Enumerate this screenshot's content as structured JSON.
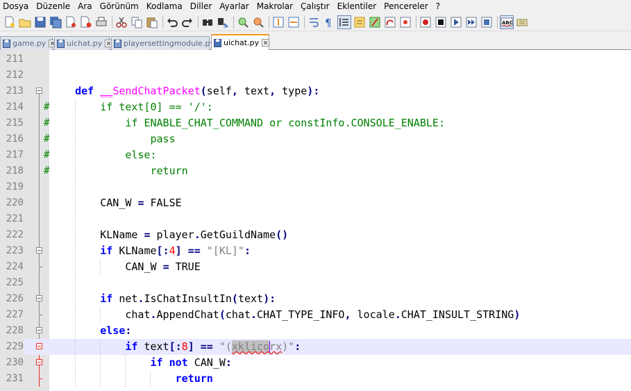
{
  "menu": [
    "Dosya",
    "Düzenle",
    "Ara",
    "Görünüm",
    "Kodlama",
    "Diller",
    "Ayarlar",
    "Makrolar",
    "Çalıştır",
    "Eklentiler",
    "Pencereler",
    "?"
  ],
  "tabs": [
    {
      "label": "game.py",
      "active": false
    },
    {
      "label": "uichat.py",
      "active": false
    },
    {
      "label": "playersettingmodule.py",
      "active": false
    },
    {
      "label": "uichat.py",
      "active": true
    }
  ],
  "toolbar_icons": [
    "new-file-icon",
    "open-file-icon",
    "save-icon",
    "save-all-icon",
    "close-icon",
    "close-all-icon",
    "print-icon",
    "cut-icon",
    "copy-icon",
    "paste-icon",
    "undo-icon",
    "redo-icon",
    "find-icon",
    "replace-icon",
    "zoom-in-icon",
    "zoom-out-icon",
    "sync-vertical-icon",
    "sync-horizontal-icon",
    "word-wrap-icon",
    "show-all-chars-icon",
    "indent-guide-icon",
    "document-map-icon",
    "function-list-icon",
    "folder-workspace-icon",
    "monitor-icon",
    "record-macro-icon",
    "stop-macro-icon",
    "play-macro-icon",
    "run-macro-multiple-icon",
    "save-macro-icon",
    "spell-check-icon",
    "spell-check-options-icon"
  ],
  "colors": {
    "keyword": "#0000ff",
    "def_keyword": "#0000ff",
    "function_name": "#ff00ff",
    "operator": "#000080",
    "comment_code": "#008000",
    "string": "#808080",
    "number": "#ff0000",
    "line_number": "#808080",
    "current_line": "#e8e8ff",
    "tab_accent": "#f29a1d"
  },
  "editor": {
    "lines": [
      {
        "n": "211",
        "bm": "",
        "text": ""
      },
      {
        "n": "212",
        "bm": "",
        "text": ""
      },
      {
        "n": "213",
        "bm": "",
        "text": "    def __SendChatPacket(self, text, type):"
      },
      {
        "n": "214",
        "bm": "#",
        "text": "        if text[0] == '/':"
      },
      {
        "n": "215",
        "bm": "#",
        "text": "            if ENABLE_CHAT_COMMAND or constInfo.CONSOLE_ENABLE:"
      },
      {
        "n": "216",
        "bm": "#",
        "text": "                pass"
      },
      {
        "n": "217",
        "bm": "#",
        "text": "            else:"
      },
      {
        "n": "218",
        "bm": "#",
        "text": "                return"
      },
      {
        "n": "219",
        "bm": "",
        "text": ""
      },
      {
        "n": "220",
        "bm": "",
        "text": "        CAN_W = FALSE"
      },
      {
        "n": "221",
        "bm": "",
        "text": ""
      },
      {
        "n": "222",
        "bm": "",
        "text": "        KLName = player.GetGuildName()"
      },
      {
        "n": "223",
        "bm": "",
        "text": "        if KLName[:4] == \"[KL]\":"
      },
      {
        "n": "224",
        "bm": "",
        "text": "            CAN_W = TRUE"
      },
      {
        "n": "225",
        "bm": "",
        "text": ""
      },
      {
        "n": "226",
        "bm": "",
        "text": "        if net.IsChatInsultIn(text):"
      },
      {
        "n": "227",
        "bm": "",
        "text": "            chat.AppendChat(chat.CHAT_TYPE_INFO, locale.CHAT_INSULT_STRING)"
      },
      {
        "n": "228",
        "bm": "",
        "text": "        else:"
      },
      {
        "n": "229",
        "bm": "",
        "text": "            if text[:8] == \"(xklicorx)\":"
      },
      {
        "n": "230",
        "bm": "",
        "text": "                if not CAN_W:"
      },
      {
        "n": "231",
        "bm": "",
        "text": "                    return"
      }
    ],
    "current_line": "229"
  }
}
